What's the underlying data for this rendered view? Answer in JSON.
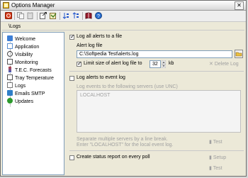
{
  "window": {
    "title": "Options Manager",
    "close_glyph": "✕"
  },
  "toolbar": {
    "buttons": [
      {
        "name": "toolbar-close-icon",
        "color": "#cc2200"
      },
      {
        "name": "toolbar-copy-icon",
        "color": "#9a9a9a"
      },
      {
        "name": "toolbar-paste-icon",
        "color": "#9a9a9a"
      },
      {
        "name": "toolbar-export-icon",
        "color": "#5a5a5a"
      },
      {
        "name": "toolbar-import-icon",
        "color": "#6b8e23"
      },
      {
        "name": "toolbar-sort-icon",
        "color": "#2255cc"
      },
      {
        "name": "toolbar-sort-reverse-icon",
        "color": "#2255cc"
      },
      {
        "name": "toolbar-book-icon",
        "color": "#8b1a1a"
      },
      {
        "name": "toolbar-help-icon",
        "color": "#2a6fd1"
      }
    ]
  },
  "address": {
    "path": "\\Logs"
  },
  "tree": {
    "items": [
      {
        "label": "Welcome",
        "icon": "welcome-icon",
        "color": "#3d7fd6"
      },
      {
        "label": "Application",
        "icon": "application-icon",
        "color": "#5a8fd0"
      },
      {
        "label": "Visibility",
        "icon": "visibility-icon",
        "color": "#444444"
      },
      {
        "label": "Monitoring",
        "icon": "monitoring-icon",
        "color": "#555555"
      },
      {
        "label": "T.E.C. Forecasts",
        "icon": "forecasts-icon",
        "color": "#c04040"
      },
      {
        "label": "Tray Temperature",
        "icon": "tray-temperature-icon",
        "color": "#555555"
      },
      {
        "label": "Logs",
        "icon": "logs-icon",
        "color": "#777777"
      },
      {
        "label": "Emails SMTP",
        "icon": "emails-icon",
        "color": "#2f7fc8"
      },
      {
        "label": "Updates",
        "icon": "updates-icon",
        "color": "#2c9a2c"
      }
    ]
  },
  "logs": {
    "log_to_file_label": "Log all alerts to a file",
    "log_to_file_checked": true,
    "alert_log_file_label": "Alert log file",
    "alert_log_file_value": "C:\\Softpedia Test\\alerts.log",
    "limit_size_label": "Limit size of alert log file to",
    "limit_size_checked": true,
    "limit_size_value": "32",
    "limit_size_unit": "kb",
    "delete_log_label": "Delete Log",
    "log_to_event_label": "Log alerts to event log",
    "log_to_event_checked": false,
    "event_servers_label": "Log events to the following servers (use UNC)",
    "event_servers_value": "LOCALHOST",
    "event_help_line1": "Separate multiple servers by a line break.",
    "event_help_line2": "Enter \"LOCALHOST\" for the local event log.",
    "test_label": "Test",
    "status_report_label": "Create status report on every poll",
    "status_report_checked": false,
    "setup_label": "Setup",
    "test2_label": "Test"
  }
}
